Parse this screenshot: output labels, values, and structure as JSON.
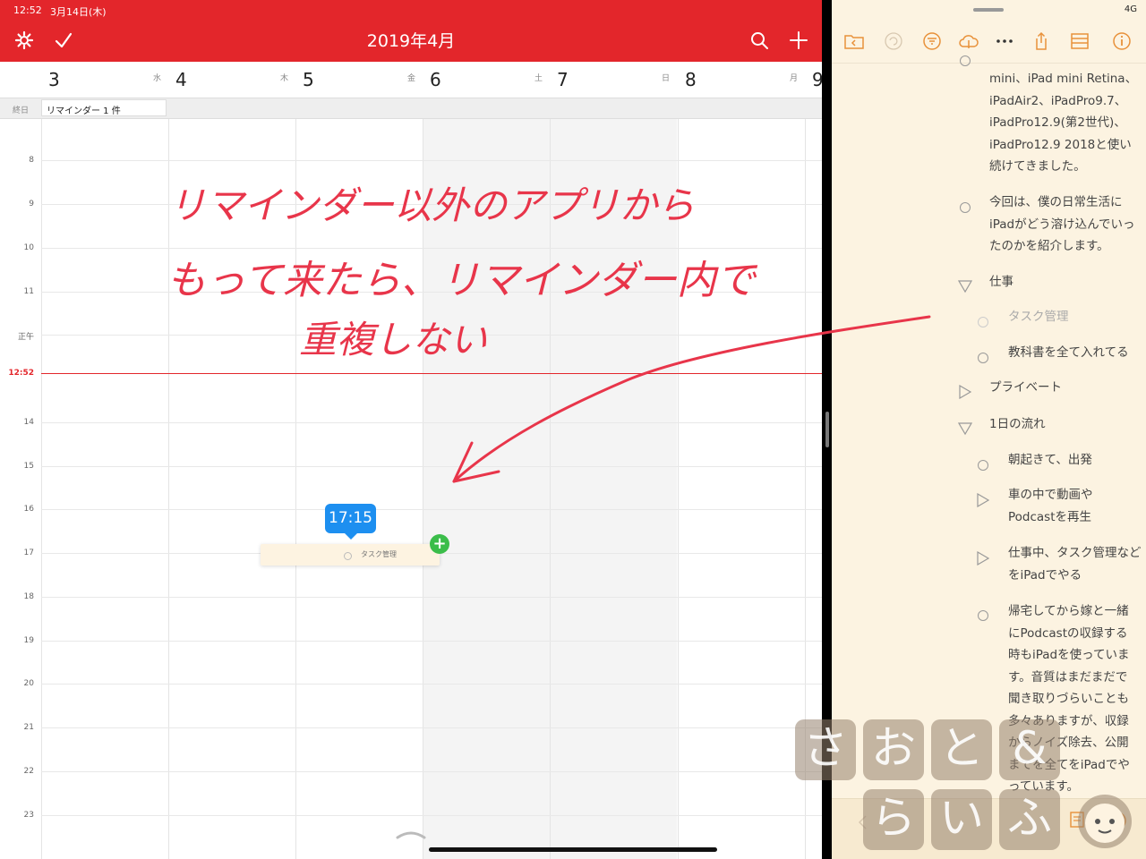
{
  "status_bar": {
    "time": "12:52",
    "date": "3月14日(木)",
    "network": "4G"
  },
  "calendar": {
    "title": "2019年4月",
    "days": [
      {
        "num": "3",
        "weekday": "水"
      },
      {
        "num": "4",
        "weekday": "木"
      },
      {
        "num": "5",
        "weekday": "金"
      },
      {
        "num": "6",
        "weekday": "土"
      },
      {
        "num": "7",
        "weekday": "日"
      },
      {
        "num": "8",
        "weekday": "月"
      },
      {
        "num": "9",
        "weekday": ""
      }
    ],
    "allday_label": "終日",
    "allday_item": "リマインダー 1 件",
    "hours": [
      "8",
      "9",
      "10",
      "11",
      "正午",
      "14",
      "15",
      "16",
      "17",
      "18",
      "19",
      "20",
      "21",
      "22",
      "23"
    ],
    "now_label": "12:52",
    "drag_item_text": "タスク管理",
    "drag_time": "17:15",
    "icons": {
      "settings": "gear-icon",
      "done": "checkmark-icon",
      "search": "search-icon",
      "add": "plus-icon"
    },
    "accent_color": "#e3262b"
  },
  "annotation": {
    "line1": "リマインダー以外のアプリから",
    "line2": "もって来たら、リマインダー内で",
    "line3": "重複しない"
  },
  "outline": {
    "items": [
      {
        "kind": "text",
        "text": "mini、iPad mini Retina、iPadAir2、iPadPro9.7、iPadPro12.9(第2世代)、iPadPro12.9 2018と使い続けてきました。"
      },
      {
        "kind": "bullet",
        "text": "今回は、僕の日常生活にiPadがどう溶け込んでいったのかを紹介します。"
      },
      {
        "kind": "open-section",
        "text": "仕事"
      },
      {
        "kind": "bullet-dim",
        "text": "タスク管理"
      },
      {
        "kind": "bullet",
        "text": "教科書を全て入れてる"
      },
      {
        "kind": "closed-section",
        "text": "プライベート"
      },
      {
        "kind": "open-section",
        "text": "1日の流れ"
      },
      {
        "kind": "bullet",
        "text": "朝起きて、出発"
      },
      {
        "kind": "closed",
        "text": "車の中で動画やPodcastを再生"
      },
      {
        "kind": "closed",
        "text": "仕事中、タスク管理などをiPadでやる"
      },
      {
        "kind": "bullet",
        "text": "帰宅してから嫁と一緒にPodcastの収録する時もiPadを使っています。音質はまだまだで聞き取りづらいことも多々ありますが、収録からノイズ除去、公開までを全てをiPadでやっています。"
      }
    ],
    "accent_color": "#e8913a"
  },
  "watermark": {
    "row1": [
      "さ",
      "お",
      "と",
      "&"
    ],
    "row2": [
      "ら",
      "い",
      "ふ"
    ]
  }
}
